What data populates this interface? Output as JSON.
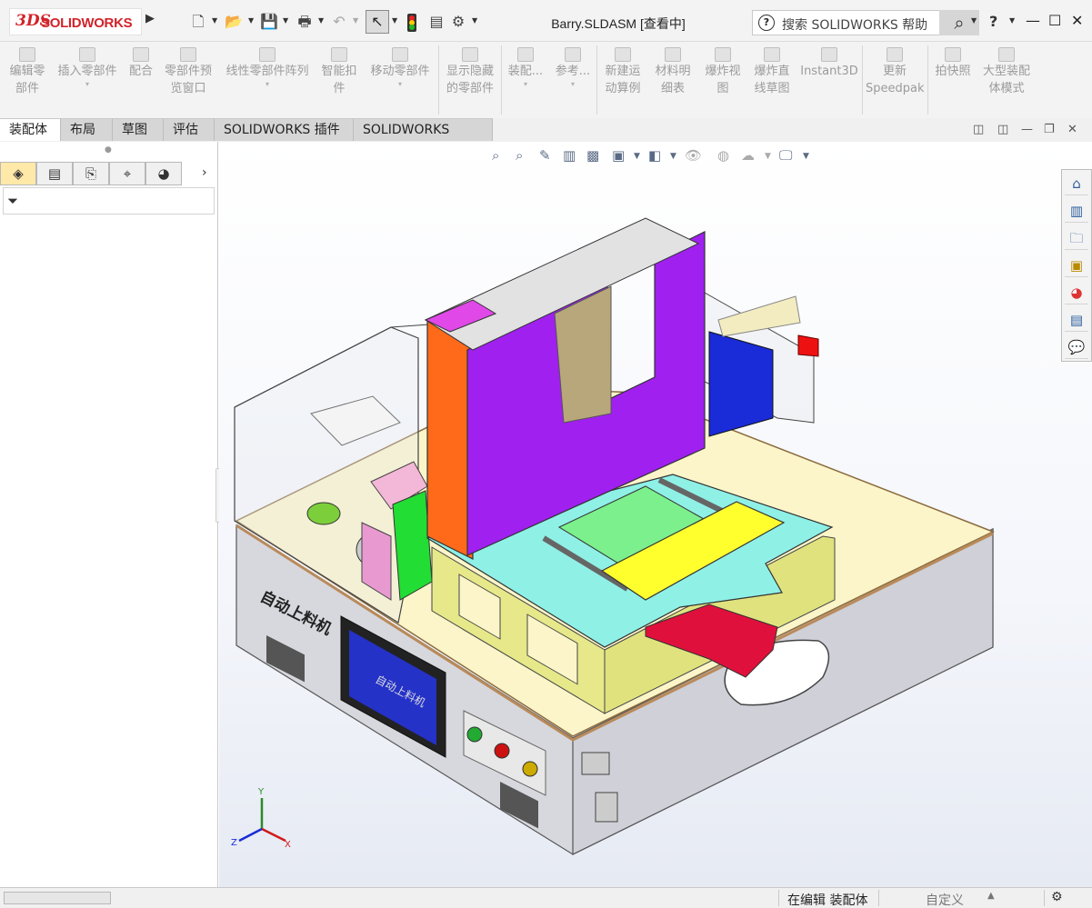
{
  "app": {
    "brand_mark": "3DS",
    "brand_name": "SOLIDWORKS",
    "document_title": "Barry.SLDASM [查看中]",
    "help_search_placeholder": "搜索 SOLIDWORKS 帮助",
    "help_label": "?"
  },
  "toolbar_tools": [
    {
      "label": "编辑零\n部件",
      "dropdown": false
    },
    {
      "label": "插入零部件",
      "dropdown": true
    },
    {
      "label": "配合",
      "dropdown": false
    },
    {
      "label": "零部件预\n览窗口",
      "dropdown": false
    },
    {
      "label": "线性零部件阵列",
      "dropdown": true
    },
    {
      "label": "智能扣\n件",
      "dropdown": false
    },
    {
      "label": "移动零部件",
      "dropdown": true
    },
    {
      "label": "显示隐藏\n的零部件",
      "dropdown": false
    },
    {
      "label": "装配...",
      "dropdown": true
    },
    {
      "label": "参考...",
      "dropdown": true
    },
    {
      "label": "新建运\n动算例",
      "dropdown": false
    },
    {
      "label": "材料明\n细表",
      "dropdown": false
    },
    {
      "label": "爆炸视\n图",
      "dropdown": false
    },
    {
      "label": "爆炸直\n线草图",
      "dropdown": false
    },
    {
      "label": "Instant3D",
      "dropdown": false
    },
    {
      "label": "更新\nSpeedpak",
      "dropdown": false
    },
    {
      "label": "拍快照",
      "dropdown": false
    },
    {
      "label": "大型装配\n体模式",
      "dropdown": false
    }
  ],
  "tabs": [
    "装配体",
    "布局",
    "草图",
    "评估",
    "SOLIDWORKS 插件",
    "SOLIDWORKS MBD"
  ],
  "active_tab": "装配体",
  "status": {
    "mode": "在编辑 装配体",
    "units": "自定义"
  },
  "model": {
    "panel_label": "自动上料机",
    "screen_text": "自动上料机"
  },
  "triad": {
    "x": "X",
    "y": "Y",
    "z": "Z"
  },
  "colors": {
    "purple_plate": "#a020f0",
    "orange_plate": "#ff6a1a",
    "cyan_plate": "#8ff0e6",
    "yellow_block": "#ffff2e",
    "green_pad": "#7cf08c",
    "red_cylinder": "#e0103c",
    "blue_motor": "#1a2bd8",
    "frame_yellow": "#e6e88a",
    "base_top": "#fbf5c9",
    "base_grey": "#d7d8de",
    "screen_blue": "#2432c8"
  }
}
